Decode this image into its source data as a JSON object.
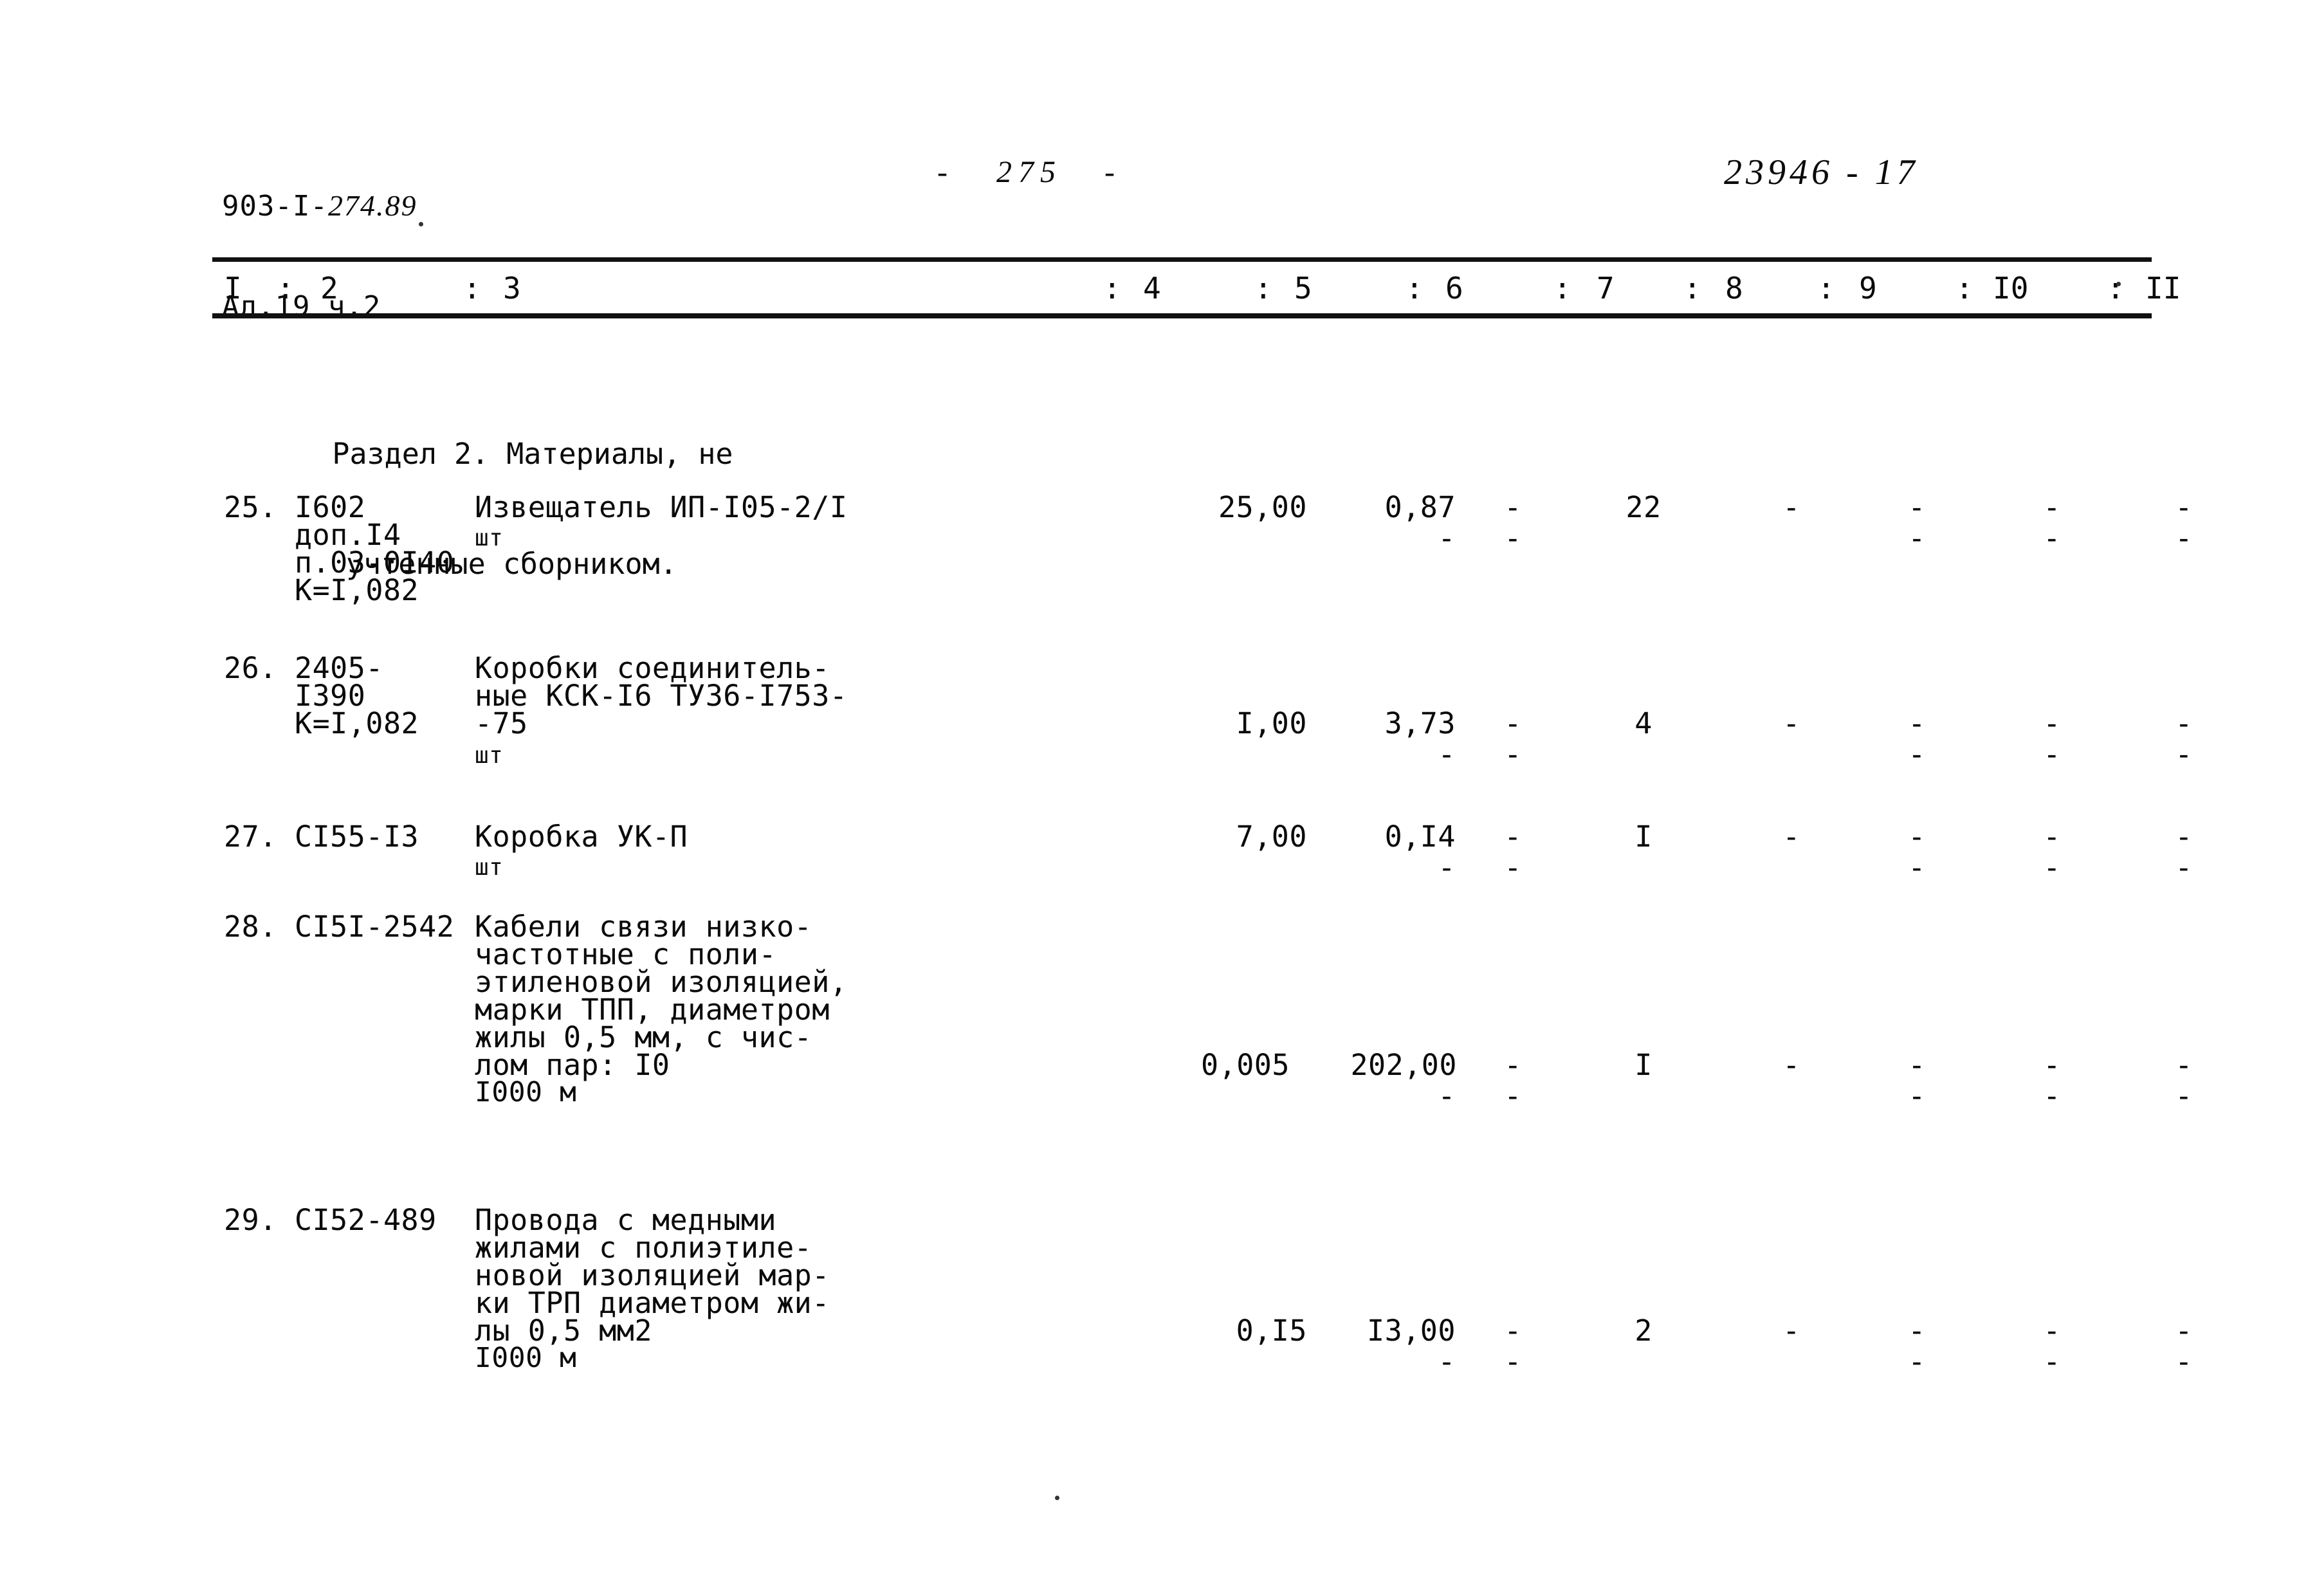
{
  "header": {
    "doc_code": "903-I-274.89",
    "doc_code_prefix": "903-I-",
    "doc_code_hand": "274.89",
    "album": "Ал.19 ч.2",
    "page_label": "-   275   -",
    "stamp_code": "23946 - 17"
  },
  "table": {
    "columns": [
      "I",
      "2",
      "3",
      "4",
      "5",
      "6",
      "7",
      "8",
      "9",
      "I0",
      "II"
    ],
    "separator": ":",
    "section": {
      "line1": "Раздел 2. Материалы, не",
      "line2": "учтенные сборником."
    },
    "rows": [
      {
        "num": "25.",
        "code_lines": [
          "I602",
          "доп.I4",
          "п.03-0I40",
          "К=I,082"
        ],
        "desc_lines": [
          "Извещатель ИП-I05-2/I"
        ],
        "unit": "шт",
        "c4": "25,00",
        "c5": "0,87",
        "c6": "-",
        "c7": "22",
        "c8": "-",
        "c9": "-",
        "c10": "-",
        "c11": "-",
        "c5_2": "-",
        "c6_2": "-",
        "c9_2": "-",
        "c10_2": "-",
        "c11_2": "-"
      },
      {
        "num": "26.",
        "code_lines": [
          "2405-",
          "I390",
          "К=I,082"
        ],
        "desc_lines": [
          "Коробки соединитель-",
          "ные КСК-I6 ТУ36-I753-",
          "-75"
        ],
        "unit": "шт",
        "c4": "I,00",
        "c5": "3,73",
        "c6": "-",
        "c7": "4",
        "c8": "-",
        "c9": "-",
        "c10": "-",
        "c11": "-",
        "c5_2": "-",
        "c6_2": "-",
        "c9_2": "-",
        "c10_2": "-",
        "c11_2": "-"
      },
      {
        "num": "27.",
        "code_lines": [
          "CI55-I3"
        ],
        "desc_lines": [
          "Коробка УК-П"
        ],
        "unit": "шт",
        "c4": "7,00",
        "c5": "0,I4",
        "c6": "-",
        "c7": "I",
        "c8": "-",
        "c9": "-",
        "c10": "-",
        "c11": "-",
        "c5_2": "-",
        "c6_2": "-",
        "c9_2": "-",
        "c10_2": "-",
        "c11_2": "-"
      },
      {
        "num": "28.",
        "code_lines": [
          "CI5I-2542"
        ],
        "desc_lines": [
          "Кабели связи низко-",
          "частотные с поли-",
          "этиленовой изоляцией,",
          "марки ТПП, диаметром",
          "жилы 0,5 мм, с чис-",
          "лом пар: I0"
        ],
        "unit": "I000 м",
        "c4": "0,005",
        "c5": "202,00",
        "c6": "-",
        "c7": "I",
        "c8": "-",
        "c9": "-",
        "c10": "-",
        "c11": "-",
        "c5_2": "-",
        "c6_2": "-",
        "c9_2": "-",
        "c10_2": "-",
        "c11_2": "-"
      },
      {
        "num": "29.",
        "code_lines": [
          "CI52-489"
        ],
        "desc_lines": [
          "Провода с медными",
          "жилами с полиэтиле-",
          "новой изоляцией мар-",
          "ки ТРП диаметром жи-",
          "лы 0,5 мм2"
        ],
        "unit": "I000 м",
        "c4": "0,I5",
        "c5": "I3,00",
        "c6": "-",
        "c7": "2",
        "c8": "-",
        "c9": "-",
        "c10": "-",
        "c11": "-",
        "c5_2": "-",
        "c6_2": "-",
        "c9_2": "-",
        "c10_2": "-",
        "c11_2": "-"
      }
    ]
  }
}
